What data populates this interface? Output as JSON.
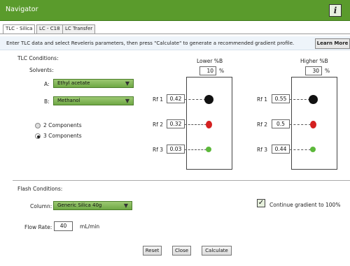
{
  "window": {
    "title": "Navigator",
    "info_icon": "i"
  },
  "tabs": [
    {
      "label": "TLC - Silica"
    },
    {
      "label": "LC - C18"
    },
    {
      "label": "LC Transfer"
    }
  ],
  "instructions": "Enter TLC data and select Reveleris parameters, then press \"Calculate\" to generate a recommended gradient profile.",
  "learn_more": "Learn More",
  "tlc": {
    "section_label": "TLC Conditions:",
    "solvents_label": "Solvents:",
    "solvent_a": {
      "label": "A:",
      "value": "Ethyl acetate"
    },
    "solvent_b": {
      "label": "B:",
      "value": "Methanol"
    },
    "components": [
      {
        "label": "2 Components",
        "selected": false
      },
      {
        "label": "3 Components",
        "selected": true
      }
    ],
    "lower": {
      "heading": "Lower %B",
      "percent": "10",
      "unit": "%",
      "rf": [
        {
          "label": "Rf 1",
          "value": "0.42",
          "color": "#111111"
        },
        {
          "label": "Rf 2",
          "value": "0.32",
          "color": "#d42020"
        },
        {
          "label": "Rf 3",
          "value": "0.03",
          "color": "#5cb83a"
        }
      ]
    },
    "higher": {
      "heading": "Higher %B",
      "percent": "30",
      "unit": "%",
      "rf": [
        {
          "label": "Rf 1",
          "value": "0.55",
          "color": "#111111"
        },
        {
          "label": "Rf 2",
          "value": "0.5",
          "color": "#d42020"
        },
        {
          "label": "Rf 3",
          "value": "0.44",
          "color": "#5cb83a"
        }
      ]
    }
  },
  "flash": {
    "section_label": "Flash Conditions:",
    "column_label": "Column:",
    "column_value": "Generic Silica 40g",
    "continue_label": "Continue gradient to 100%",
    "continue_checked": true,
    "check_mark": "✓",
    "flow_label": "Flow Rate:",
    "flow_value": "40",
    "flow_unit": "mL/min"
  },
  "buttons": {
    "reset": "Reset",
    "close": "Close",
    "calculate": "Calculate"
  },
  "colors": {
    "titlebar": "#5a9b2c",
    "dropdown": "#7fb456",
    "black_spot": "#111111",
    "red_spot": "#d42020",
    "green_spot": "#5cb83a"
  }
}
